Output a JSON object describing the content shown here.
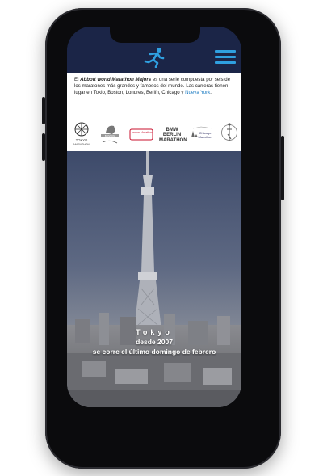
{
  "info": {
    "text_prefix": "El",
    "brand": "Abbott world Marathon Majors",
    "text_main": "es una serie compuesta por seis de los maratones más grandes y famosos del mundo. Las carreras tienen lugar en Tokio, Boston, Londres, Berlín, Chicago y",
    "link_city": "Nueva York",
    "text_end": "."
  },
  "logos": [
    {
      "name": "TOKYO",
      "sub": "MARATHON"
    },
    {
      "name": "BOSTON MARATHON",
      "sub": ""
    },
    {
      "name": "London Marathon",
      "sub": ""
    },
    {
      "name": "BMW BERLIN MARATHON",
      "sub": ""
    },
    {
      "name": "Chicago Marathon",
      "sub": ""
    },
    {
      "name": "NYC Marathon",
      "sub": ""
    }
  ],
  "hero": {
    "city": "Tokyo",
    "since": "desde 2007",
    "when": "se corre el último domingo de febrero"
  },
  "colors": {
    "header_bg": "#1b2547",
    "accent": "#2fa0e0",
    "link": "#1b7bc2"
  },
  "icons": {
    "logo": "runner-icon",
    "menu": "hamburger-menu-icon"
  }
}
